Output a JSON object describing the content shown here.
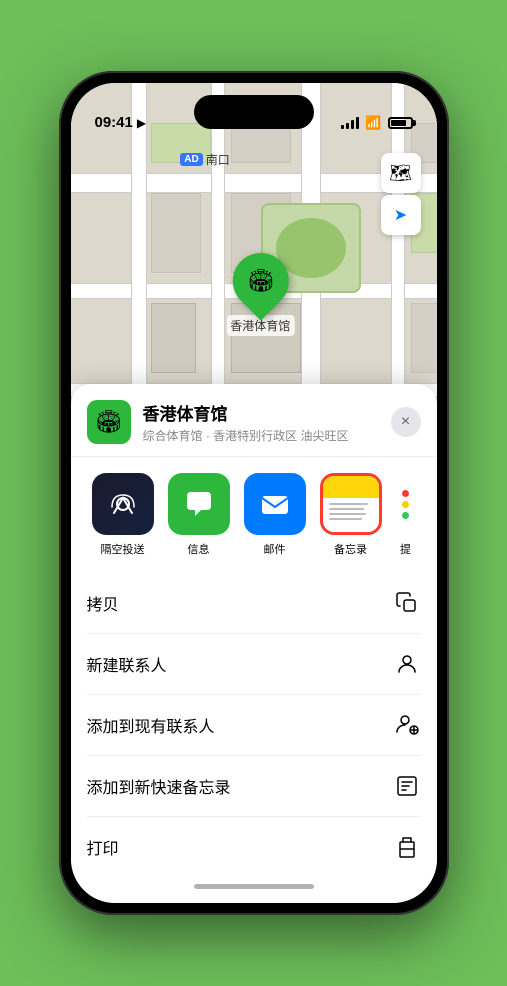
{
  "status_bar": {
    "time": "09:41",
    "signal": "●●●●",
    "wifi": "WiFi",
    "battery": "Battery"
  },
  "map": {
    "label": "南口",
    "label_prefix": "AD",
    "pin_label": "香港体育馆",
    "pin_emoji": "🏟"
  },
  "map_controls": {
    "map_btn": "🗺",
    "location_btn": "➤"
  },
  "venue": {
    "name": "香港体育馆",
    "description": "综合体育馆 · 香港特别行政区 油尖旺区",
    "icon_emoji": "🏟"
  },
  "share_apps": [
    {
      "id": "airdrop",
      "label": "隔空投送",
      "type": "airdrop"
    },
    {
      "id": "messages",
      "label": "信息",
      "type": "messages"
    },
    {
      "id": "mail",
      "label": "邮件",
      "type": "mail"
    },
    {
      "id": "notes",
      "label": "备忘录",
      "type": "notes",
      "selected": true
    },
    {
      "id": "more",
      "label": "提",
      "type": "more"
    }
  ],
  "actions": [
    {
      "id": "copy",
      "label": "拷贝",
      "icon": "copy"
    },
    {
      "id": "new-contact",
      "label": "新建联系人",
      "icon": "person"
    },
    {
      "id": "add-contact",
      "label": "添加到现有联系人",
      "icon": "person-add"
    },
    {
      "id": "new-note",
      "label": "添加到新快速备忘录",
      "icon": "note"
    },
    {
      "id": "print",
      "label": "打印",
      "icon": "print"
    }
  ],
  "close_btn": "×",
  "more_dots_colors": [
    "#ff3b30",
    "#ffcc00",
    "#34c759"
  ],
  "partial_label": "提"
}
